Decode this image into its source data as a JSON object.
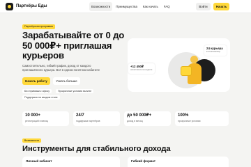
{
  "header": {
    "brand": "Партнёры Еды",
    "nav": [
      "Возможности",
      "Преимущества",
      "Как начать",
      "FAQ"
    ],
    "login_label": "Войти",
    "start_label": "Начать"
  },
  "hero": {
    "badge": "Партнёрская программа",
    "title": "Зарабатывайте от 0 до 50 000₽+ приглашая курьеров",
    "description": "Самостоятельно, гибкий график, доход от каждого приглашённого курьера. Всё в одном понятном кабинете",
    "primary_button": "Начать работу",
    "secondary_button": "Узнать больше",
    "chips": [
      "Без привязки к офису",
      "Прозрачные условия выплат",
      "Поддержка на каждом этапе"
    ],
    "card_couriers_value": "24 курьера",
    "card_couriers_label": "в этом месяце",
    "card_income_value": "+12 450₽",
    "card_income_label": "начисление на неделе"
  },
  "stats": [
    {
      "value": "10 000+",
      "label": "регистраций в месяц"
    },
    {
      "value": "24/7",
      "label": "поддержка партнёров"
    },
    {
      "value": "до 50 000₽+",
      "label": "доход в месяц"
    },
    {
      "value": "100%",
      "label": "прозрачные условия"
    }
  ],
  "features": {
    "badge": "Возможности",
    "title": "Инструменты для стабильного дохода",
    "cards": [
      "Личный кабинет",
      "Гибкий формат"
    ]
  },
  "colors": {
    "accent": "#ffd83a",
    "background": "#f4f4f2",
    "card": "#ffffff",
    "dark": "#1d1d1d"
  }
}
